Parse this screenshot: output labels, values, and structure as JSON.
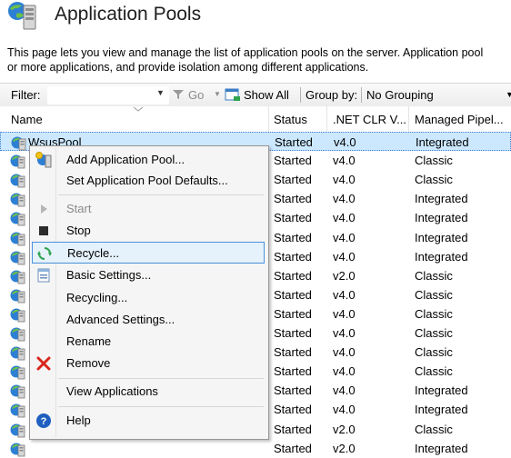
{
  "header": {
    "title": "Application Pools",
    "description_line1": "This page lets you view and manage the list of application pools on the server. Application pool",
    "description_line2": "or more applications, and provide isolation among different applications."
  },
  "filter_bar": {
    "filter_label": "Filter:",
    "filter_value": "",
    "go_label": "Go",
    "show_all_label": "Show All",
    "group_by_label": "Group by:",
    "group_by_value": "No Grouping"
  },
  "columns": {
    "name": "Name",
    "status": "Status",
    "clr": ".NET CLR V...",
    "pipeline": "Managed Pipel..."
  },
  "rows": [
    {
      "name": "WsusPool",
      "status": "Started",
      "clr": "v4.0",
      "pipeline": "Integrated",
      "selected": true
    },
    {
      "name": "",
      "status": "Started",
      "clr": "v4.0",
      "pipeline": "Classic"
    },
    {
      "name": "",
      "status": "Started",
      "clr": "v4.0",
      "pipeline": "Classic"
    },
    {
      "name": "",
      "status": "Started",
      "clr": "v4.0",
      "pipeline": "Integrated"
    },
    {
      "name": "",
      "status": "Started",
      "clr": "v4.0",
      "pipeline": "Integrated"
    },
    {
      "name": "",
      "status": "Started",
      "clr": "v4.0",
      "pipeline": "Integrated"
    },
    {
      "name": "",
      "status": "Started",
      "clr": "v4.0",
      "pipeline": "Integrated"
    },
    {
      "name": "",
      "status": "Started",
      "clr": "v2.0",
      "pipeline": "Classic"
    },
    {
      "name": "",
      "status": "Started",
      "clr": "v4.0",
      "pipeline": "Classic"
    },
    {
      "name": "",
      "status": "Started",
      "clr": "v4.0",
      "pipeline": "Classic"
    },
    {
      "name": "",
      "status": "Started",
      "clr": "v4.0",
      "pipeline": "Classic"
    },
    {
      "name": "",
      "status": "Started",
      "clr": "v4.0",
      "pipeline": "Classic"
    },
    {
      "name": "",
      "status": "Started",
      "clr": "v4.0",
      "pipeline": "Classic"
    },
    {
      "name": "",
      "status": "Started",
      "clr": "v4.0",
      "pipeline": "Integrated"
    },
    {
      "name": "",
      "status": "Started",
      "clr": "v4.0",
      "pipeline": "Integrated"
    },
    {
      "name": "",
      "status": "Started",
      "clr": "v2.0",
      "pipeline": "Classic"
    },
    {
      "name": "",
      "status": "Started",
      "clr": "v2.0",
      "pipeline": "Integrated"
    }
  ],
  "context_menu": {
    "add_pool": "Add Application Pool...",
    "set_defaults": "Set Application Pool Defaults...",
    "start": "Start",
    "stop": "Stop",
    "recycle": "Recycle...",
    "basic_settings": "Basic Settings...",
    "recycling": "Recycling...",
    "advanced_settings": "Advanced Settings...",
    "rename": "Rename",
    "remove": "Remove",
    "view_applications": "View Applications",
    "help": "Help"
  },
  "icons": {
    "header": "application-pools-icon",
    "row": "app-pool-icon",
    "go": "go-funnel-icon",
    "show_all": "show-all-icon"
  },
  "colors": {
    "selection": "#cce8ff",
    "menu_hover": "#e5f1fb",
    "menu_hover_border": "#4a90d9",
    "remove_x": "#d9261c",
    "help_blue": "#1f5fbf"
  }
}
